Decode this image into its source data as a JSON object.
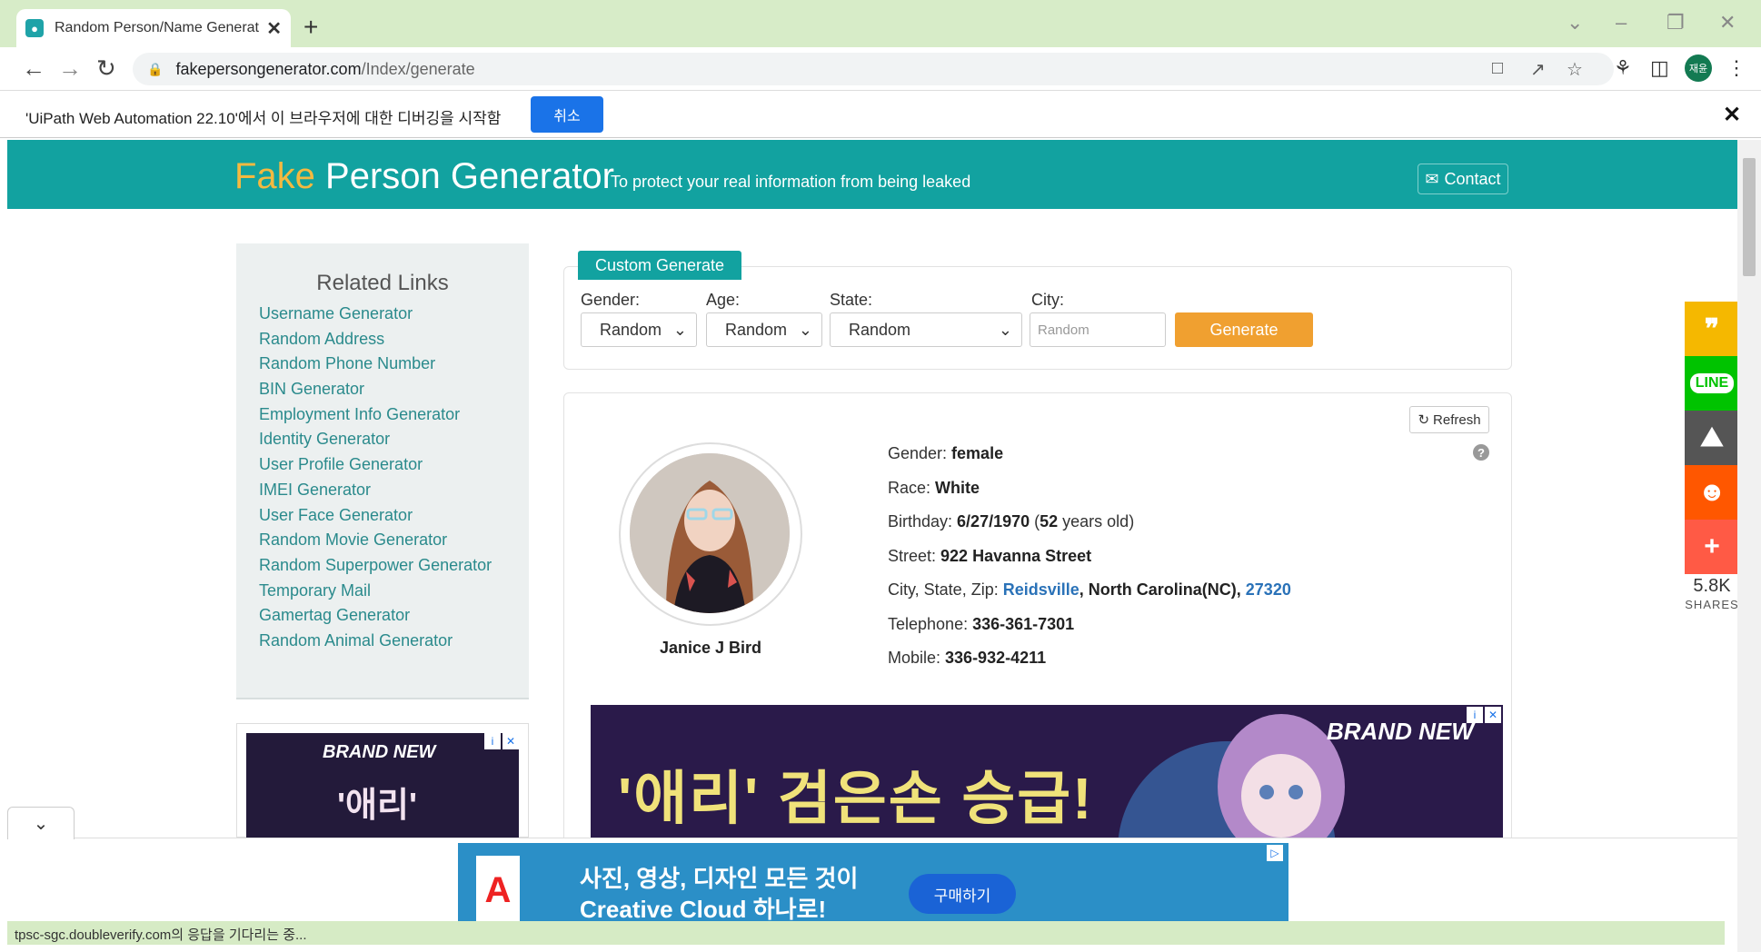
{
  "browser": {
    "tab_title": "Random Person/Name Generato",
    "url_host": "fakepersongenerator.com",
    "url_path": "/Index/generate",
    "profile_initials": "재윤"
  },
  "debug_bar": {
    "message": "'UiPath Web Automation 22.10'에서 이 브라우저에 대한 디버깅을 시작함",
    "cancel_label": "취소"
  },
  "header": {
    "logo_fake": "Fake",
    "logo_rest": " Person Generator",
    "tagline": "To protect your real information from being leaked",
    "contact_label": "Contact"
  },
  "sidebar": {
    "title": "Related Links",
    "items": [
      "Username Generator",
      "Random Address",
      "Random Phone Number",
      "BIN Generator",
      "Employment Info Generator",
      "Identity Generator",
      "User Profile Generator",
      "IMEI Generator",
      "User Face Generator",
      "Random Movie Generator",
      "Random Superpower Generator",
      "Temporary Mail",
      "Gamertag Generator",
      "Random Animal Generator"
    ]
  },
  "custom": {
    "tab_label": "Custom Generate",
    "gender_label": "Gender:",
    "gender_value": "Random",
    "age_label": "Age:",
    "age_value": "Random",
    "state_label": "State:",
    "state_value": "Random",
    "city_label": "City:",
    "city_placeholder": "Random",
    "generate_label": "Generate"
  },
  "person": {
    "refresh_label": "Refresh",
    "name": "Janice J Bird",
    "gender_label": "Gender: ",
    "gender": "female",
    "race_label": "Race: ",
    "race": "White",
    "birthday_label": "Birthday: ",
    "birthday": "6/27/1970",
    "age_open": " (",
    "age": "52",
    "age_suffix": " years old)",
    "street_label": "Street: ",
    "street": "922 Havanna Street",
    "csz_label": "City, State, Zip: ",
    "city": "Reidsville",
    "state_sep": ", ",
    "state": "North Carolina(NC)",
    "zip_sep": ", ",
    "zip": "27320",
    "telephone_label": "Telephone: ",
    "telephone": "336-361-7301",
    "mobile_label": "Mobile: ",
    "mobile": "336-932-4211"
  },
  "ads": {
    "big_text": "'애리' 검은손 승급!",
    "big_brand": "BRAND NEW",
    "left_brand": "BRAND NEW",
    "left_text": "'애리'",
    "bottom_copy_line1": "사진, 영상, 디자인 모든 것이",
    "bottom_copy_line2": "Creative Cloud 하나로!",
    "bottom_buy": "구매하기",
    "bottom_logo": "A"
  },
  "share": {
    "count": "5.8K",
    "label": "SHARES",
    "colors": [
      "#f5b800",
      "#00c300",
      "#555555",
      "#ff5700",
      "#ff5a45"
    ],
    "icons": [
      "kakao-icon",
      "line-icon",
      "car-icon",
      "reddit-icon",
      "plus-icon"
    ]
  },
  "status_bar": "tpsc-sgc.doubleverify.com의 응답을 기다리는 중..."
}
